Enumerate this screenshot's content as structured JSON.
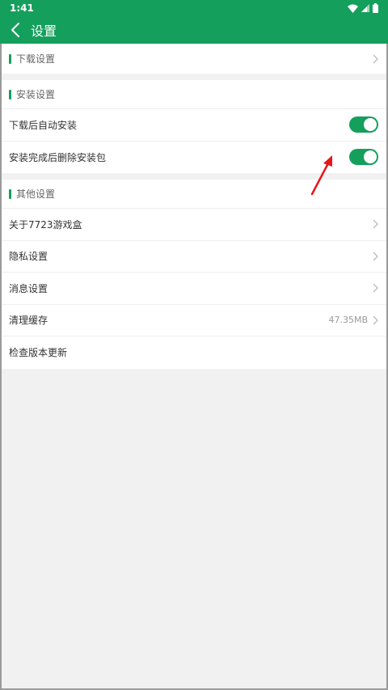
{
  "status": {
    "time": "1:41"
  },
  "appbar": {
    "title": "设置"
  },
  "sections": {
    "download": {
      "title": "下载设置"
    },
    "install": {
      "title": "安装设置",
      "items": [
        {
          "label": "下载后自动安装",
          "enabled": true
        },
        {
          "label": "安装完成后删除安装包",
          "enabled": true
        }
      ]
    },
    "other": {
      "title": "其他设置",
      "items": [
        {
          "label": "关于7723游戏盒"
        },
        {
          "label": "隐私设置"
        },
        {
          "label": "消息设置"
        },
        {
          "label": "清理缓存",
          "value": "47.35MB"
        },
        {
          "label": "检查版本更新"
        }
      ]
    }
  },
  "colors": {
    "accent": "#159f5c",
    "annotation": "#e8161b"
  },
  "icons": [
    "back-arrow-icon",
    "chevron-right-icon",
    "wifi-icon",
    "signal-icon",
    "battery-icon"
  ]
}
